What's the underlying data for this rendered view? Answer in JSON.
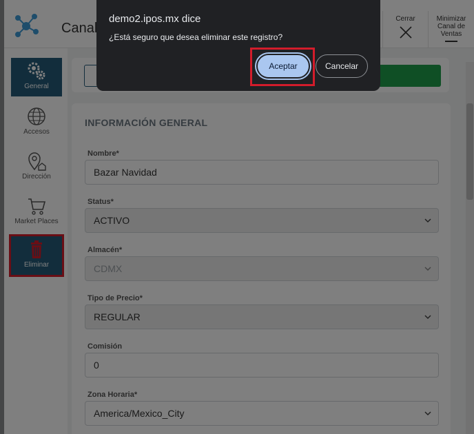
{
  "header": {
    "title": "Canal",
    "close_label": "Cerrar",
    "minimize_label": "Minimizar Canal de Ventas"
  },
  "sidebar": {
    "items": [
      {
        "label": "General",
        "icon": "gears-icon"
      },
      {
        "label": "Accesos",
        "icon": "globe-icon"
      },
      {
        "label": "Dirección",
        "icon": "location-icon"
      },
      {
        "label": "Market Places",
        "icon": "cart-icon"
      },
      {
        "label": "Eliminar",
        "icon": "trash-icon"
      }
    ]
  },
  "form": {
    "section_title": "INFORMACIÓN GENERAL",
    "nombre_label": "Nombre*",
    "nombre_value": "Bazar Navidad",
    "status_label": "Status*",
    "status_value": "ACTIVO",
    "almacen_label": "Almacén*",
    "almacen_value": "CDMX",
    "tipo_precio_label": "Tipo de Precio*",
    "tipo_precio_value": "REGULAR",
    "comision_label": "Comisión",
    "comision_value": "0",
    "zona_label": "Zona Horaria*",
    "zona_value": "America/Mexico_City"
  },
  "dialog": {
    "title": "demo2.ipos.mx dice",
    "message": "¿Está seguro que desea eliminar este registro?",
    "ok_label": "Aceptar",
    "cancel_label": "Cancelar"
  },
  "colors": {
    "accent": "#245b78",
    "highlight": "#d31c2b",
    "ok_button": "#aac7f0",
    "dialog_bg": "#202124"
  }
}
